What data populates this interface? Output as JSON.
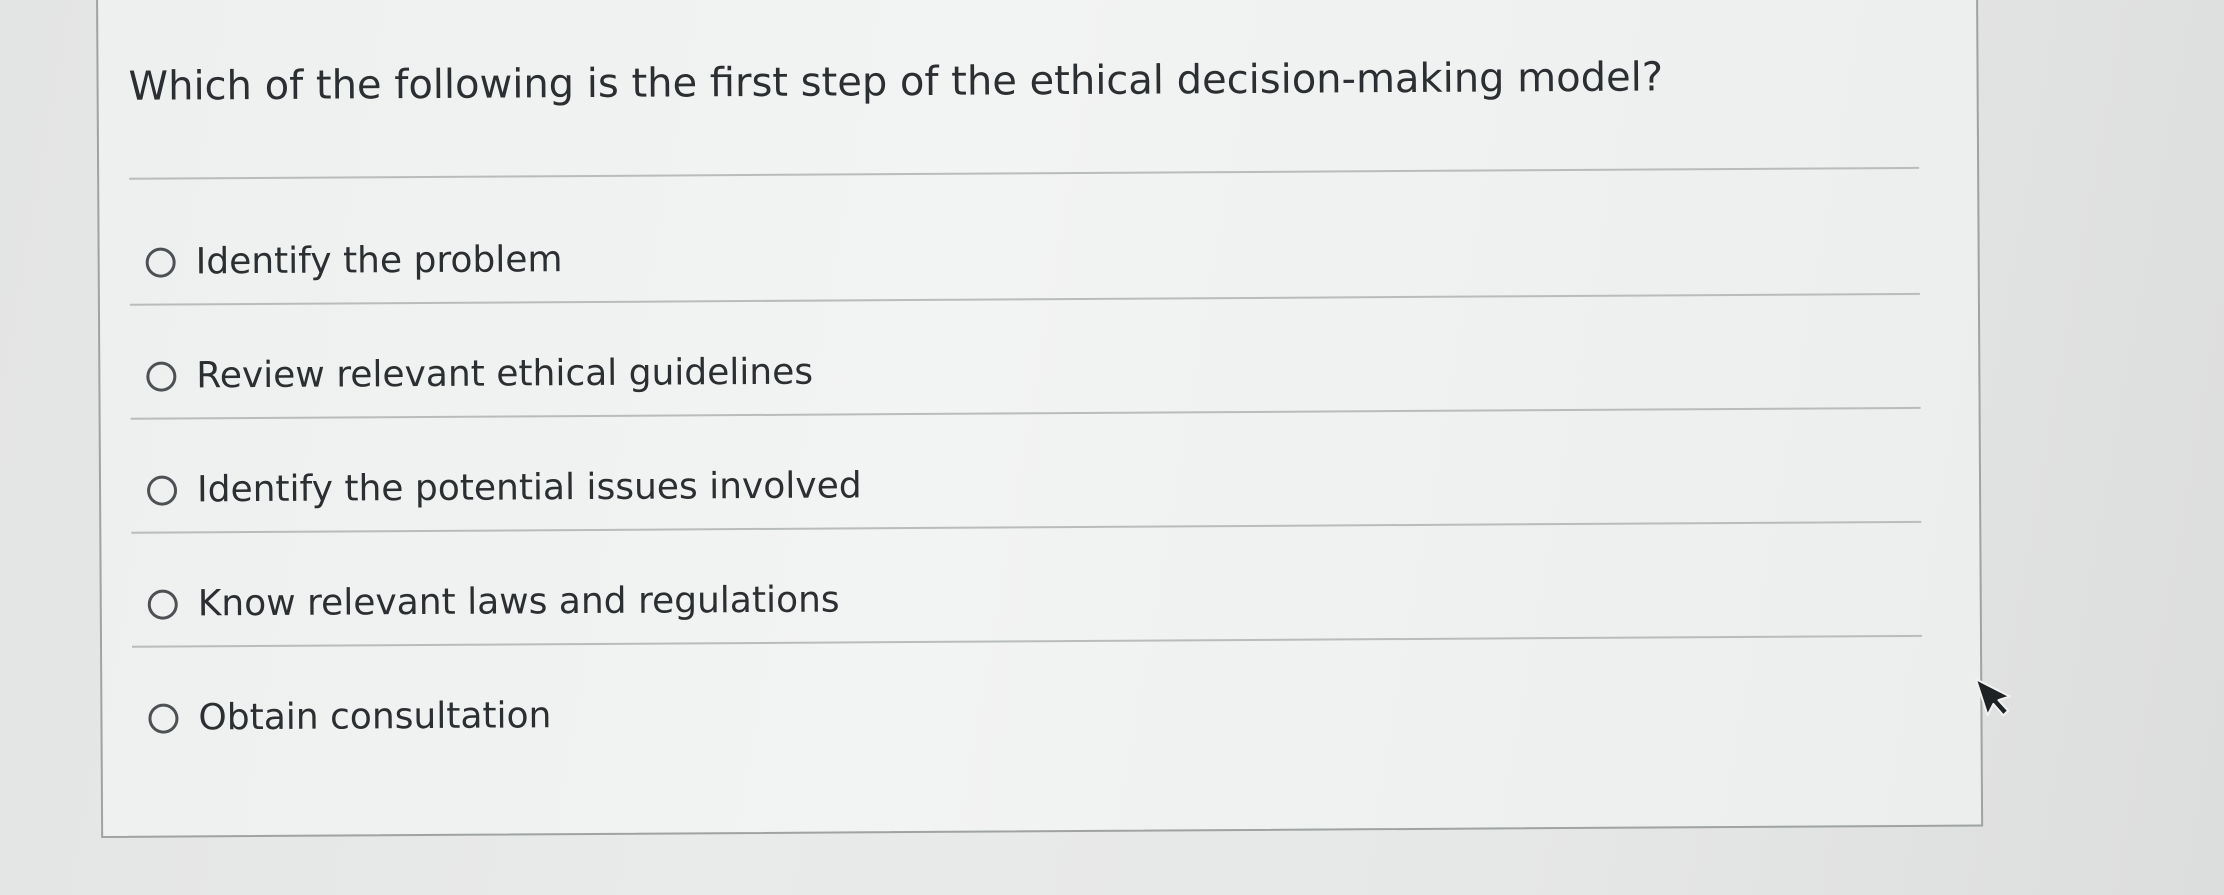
{
  "question": {
    "text": "Which of the following is the first step of the ethical decision-making model?"
  },
  "choices": [
    {
      "label": "Identify the problem",
      "selected": false
    },
    {
      "label": "Review relevant ethical guidelines",
      "selected": false
    },
    {
      "label": "Identify the potential issues involved",
      "selected": false
    },
    {
      "label": "Know relevant laws and regulations",
      "selected": false
    },
    {
      "label": "Obtain consultation",
      "selected": false
    }
  ],
  "icons": {
    "radio": "radio-unselected-icon",
    "cursor": "mouse-pointer-icon"
  },
  "colors": {
    "text": "#2c2f31",
    "card_border": "#9fa3a3",
    "divider": "#b9bcbc",
    "background": "#e6e7e7"
  }
}
